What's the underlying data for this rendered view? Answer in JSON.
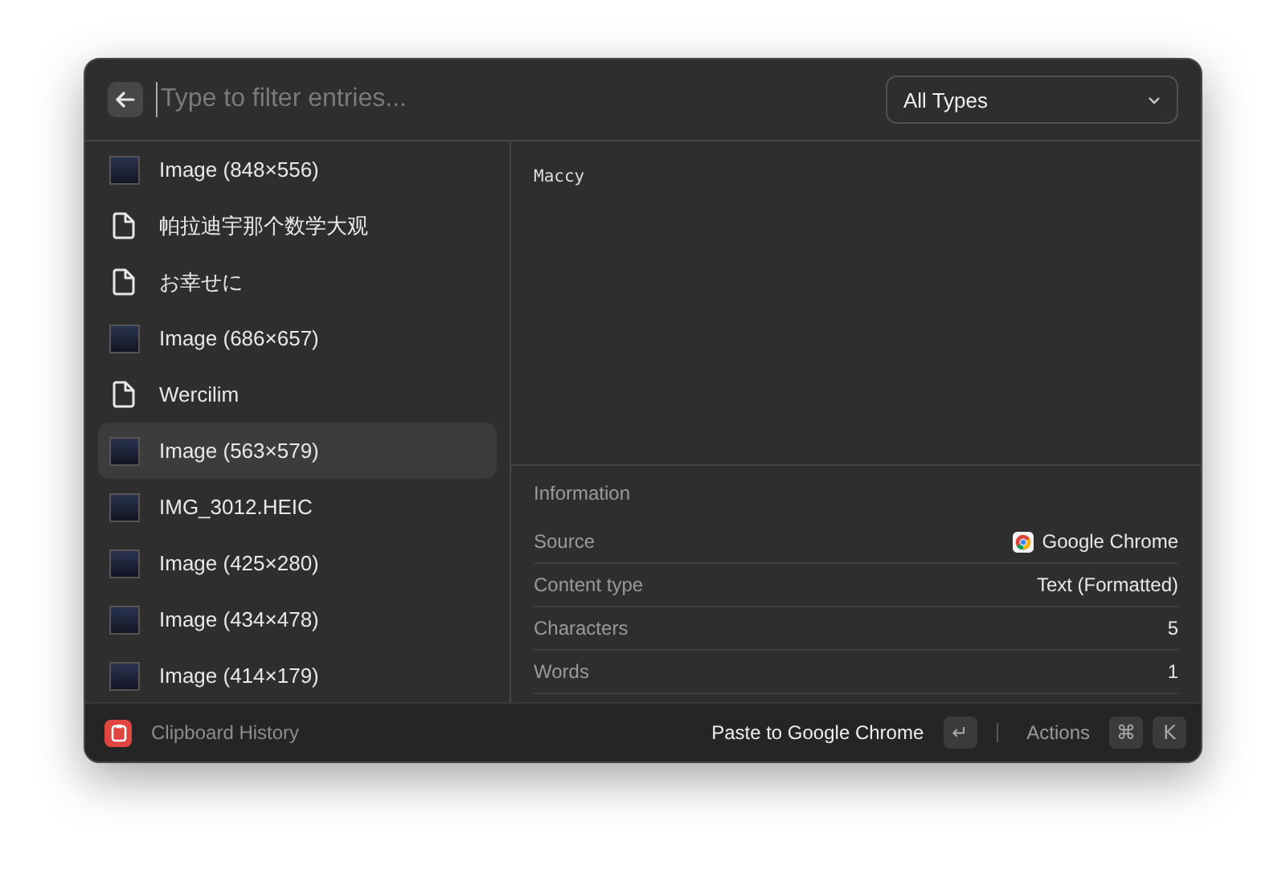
{
  "search": {
    "placeholder": "Type to filter entries..."
  },
  "type_filter": {
    "value": "All Types"
  },
  "entries": [
    {
      "kind": "image",
      "label": "Image (848×556)",
      "selected": false
    },
    {
      "kind": "text",
      "label": "帕拉迪宇那个数学大观",
      "selected": false
    },
    {
      "kind": "text",
      "label": "お幸せに",
      "selected": false
    },
    {
      "kind": "image",
      "label": "Image (686×657)",
      "selected": false
    },
    {
      "kind": "text",
      "label": "Wercilim",
      "selected": false
    },
    {
      "kind": "image",
      "label": "Image (563×579)",
      "selected": true
    },
    {
      "kind": "image",
      "label": "IMG_3012.HEIC",
      "selected": false
    },
    {
      "kind": "image",
      "label": "Image (425×280)",
      "selected": false
    },
    {
      "kind": "image",
      "label": "Image (434×478)",
      "selected": false
    },
    {
      "kind": "image",
      "label": "Image (414×179)",
      "selected": false
    }
  ],
  "preview": {
    "text": "Maccy"
  },
  "information": {
    "title": "Information",
    "rows": [
      {
        "label": "Source",
        "value": "Google Chrome",
        "app_icon": true
      },
      {
        "label": "Content type",
        "value": "Text (Formatted)",
        "app_icon": false
      },
      {
        "label": "Characters",
        "value": "5",
        "app_icon": false
      },
      {
        "label": "Words",
        "value": "1",
        "app_icon": false
      }
    ]
  },
  "footer": {
    "title": "Clipboard History",
    "primary_action": "Paste to Google Chrome",
    "primary_key": "↵",
    "actions_label": "Actions",
    "action_keys": [
      "⌘",
      "K"
    ]
  }
}
